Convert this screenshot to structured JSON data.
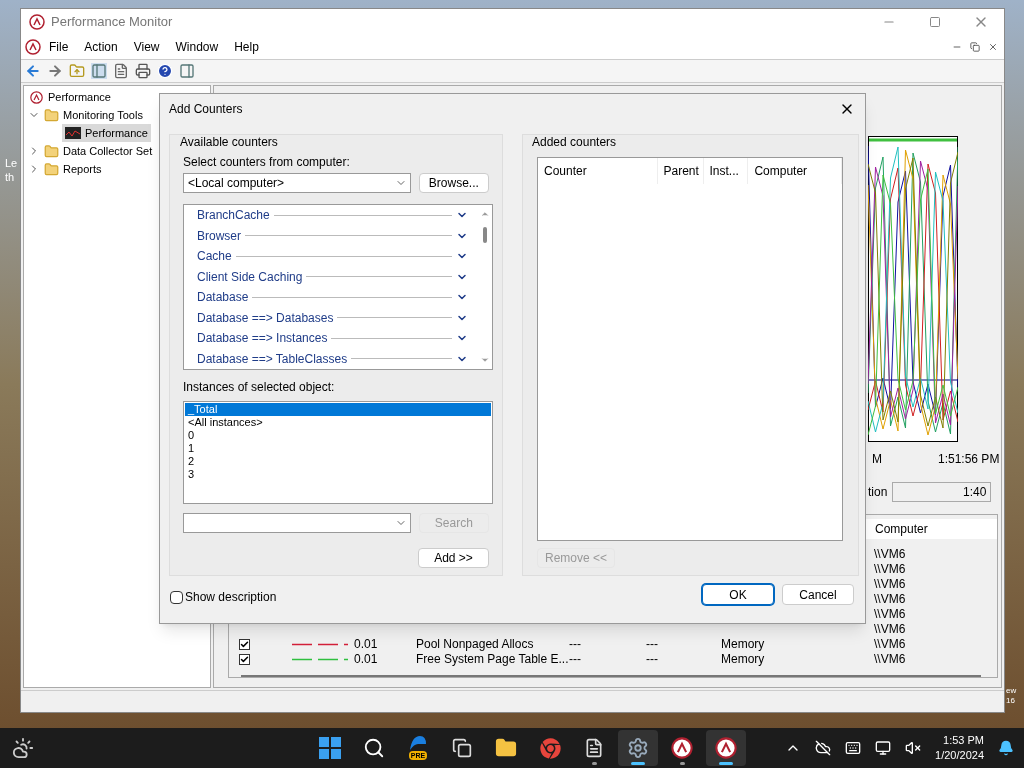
{
  "desktop": {
    "left_texts": [
      "Le",
      "th"
    ],
    "right_texts": [
      "ew",
      "16"
    ]
  },
  "main_window": {
    "title": "Performance Monitor",
    "menu": [
      "File",
      "Action",
      "View",
      "Window",
      "Help"
    ],
    "tree": {
      "label": "Performance",
      "children": [
        {
          "label": "Monitoring Tools",
          "expanded": true,
          "children": [
            {
              "label": "Performance",
              "selected": true
            }
          ]
        },
        {
          "label": "Data Collector Set",
          "expanded": false
        },
        {
          "label": "Reports",
          "expanded": false
        }
      ]
    },
    "graph": {
      "time_labels": [
        "M",
        "1:51:56 PM"
      ],
      "duration_label": "tion",
      "duration_value": "1:40"
    },
    "legend": {
      "columns": [
        "Computer"
      ],
      "rows": [
        {
          "kind": "partial",
          "computer": "\\\\VM6"
        },
        {
          "kind": "partial",
          "computer": "\\\\VM6"
        },
        {
          "kind": "partial",
          "computer": "\\\\VM6"
        },
        {
          "kind": "partial",
          "computer": "\\\\VM6"
        },
        {
          "kind": "partial",
          "computer": "\\\\VM6"
        },
        {
          "kind": "partial",
          "computer": "\\\\VM6"
        },
        {
          "kind": "full",
          "checked": true,
          "color": "#d3203a",
          "value": "0.01",
          "counter": "Pool Nonpaged Allocs",
          "instance": "---",
          "parent": "---",
          "object": "Memory",
          "computer": "\\\\VM6"
        },
        {
          "kind": "full",
          "checked": true,
          "color": "#2fbf3f",
          "value": "0.01",
          "counter": "Free System Page Table E...",
          "instance": "---",
          "parent": "---",
          "object": "Memory",
          "computer": "\\\\VM6"
        }
      ]
    }
  },
  "dialog": {
    "title": "Add Counters",
    "available": {
      "group_label": "Available counters",
      "computer_label": "Select counters from computer:",
      "computer_value": "<Local computer>",
      "browse": "Browse...",
      "counters": [
        "BranchCache",
        "Browser",
        "Cache",
        "Client Side Caching",
        "Database",
        "Database ==> Databases",
        "Database ==> Instances",
        "Database ==> TableClasses"
      ],
      "instances_label": "Instances of selected object:",
      "instances": [
        {
          "label": "_Total",
          "selected": true
        },
        {
          "label": "<All instances>",
          "selected": false
        },
        {
          "label": "0",
          "selected": false
        },
        {
          "label": "1",
          "selected": false
        },
        {
          "label": "2",
          "selected": false
        },
        {
          "label": "3",
          "selected": false
        }
      ],
      "search": {
        "label": "Search",
        "disabled": true
      },
      "add": "Add >>"
    },
    "added": {
      "group_label": "Added counters",
      "columns": [
        "Counter",
        "Parent",
        "Inst...",
        "Computer"
      ],
      "remove": {
        "label": "Remove <<",
        "disabled": true
      }
    },
    "show_description": {
      "label": "Show description",
      "checked": false
    },
    "buttons": [
      {
        "label": "OK",
        "default": true
      },
      {
        "label": "Cancel",
        "default": false
      }
    ]
  },
  "taskbar": {
    "apps": [
      {
        "kind": "start",
        "open": false,
        "active": false
      },
      {
        "kind": "search",
        "open": false,
        "active": false
      },
      {
        "kind": "copilot",
        "badge": "PRE",
        "open": false,
        "active": false
      },
      {
        "kind": "taskview",
        "open": false,
        "active": false
      },
      {
        "kind": "explorer",
        "open": false,
        "active": false
      },
      {
        "kind": "chrome",
        "open": false,
        "active": false
      },
      {
        "kind": "notepad",
        "open": true,
        "active": false
      },
      {
        "kind": "settings",
        "open": true,
        "active": true
      },
      {
        "kind": "perfmon",
        "open": true,
        "active": false
      },
      {
        "kind": "perfmon",
        "open": true,
        "active": true
      }
    ],
    "time": "1:53 PM",
    "date": "1/20/2024"
  }
}
